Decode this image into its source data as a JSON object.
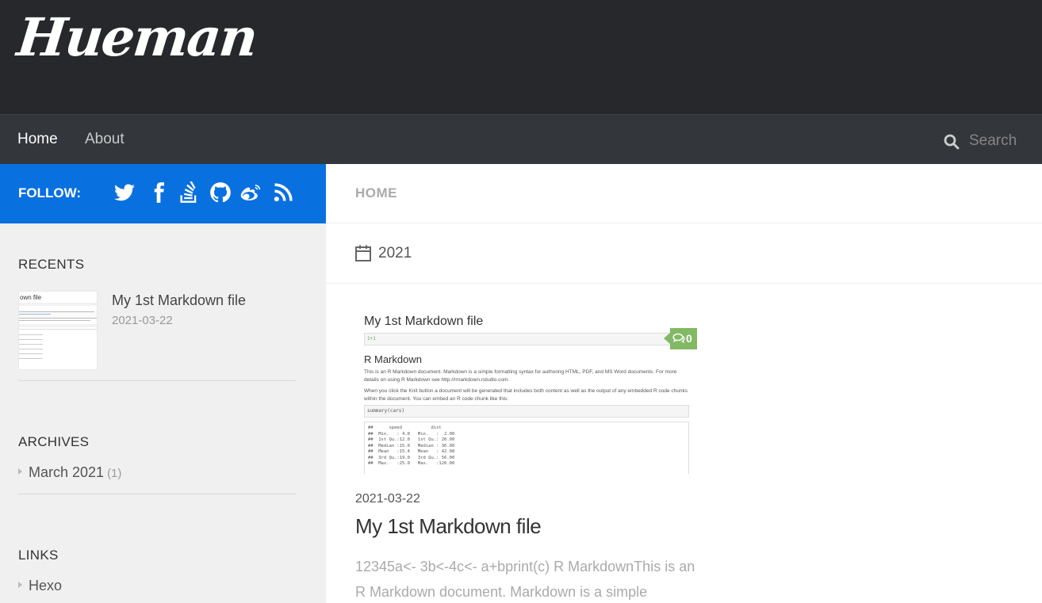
{
  "header": {
    "logo_text": "Hueman"
  },
  "nav": {
    "items": [
      {
        "label": "Home",
        "active": true
      },
      {
        "label": "About",
        "active": false
      }
    ],
    "search_placeholder": "Search"
  },
  "sidebar": {
    "follow_label": "FOLLOW:",
    "social_icons": [
      "twitter-icon",
      "facebook-icon",
      "stackoverflow-icon",
      "github-icon",
      "weibo-icon",
      "rss-icon"
    ],
    "recents": {
      "title": "RECENTS",
      "items": [
        {
          "title": "My 1st Markdown file",
          "date": "2021-03-22"
        }
      ]
    },
    "archives": {
      "title": "ARCHIVES",
      "items": [
        {
          "label": "March 2021",
          "count": "(1)"
        }
      ]
    },
    "links": {
      "title": "LINKS",
      "items": [
        {
          "label": "Hexo"
        }
      ]
    }
  },
  "main": {
    "breadcrumb": "HOME",
    "archive_year": "2021",
    "post": {
      "thumbnail": {
        "title": "My 1st Markdown file",
        "code1": "1+1",
        "h2": "R Markdown",
        "p1": "This is an R Markdown document. Markdown is a simple formatting syntax for authoring HTML, PDF, and MS Word documents. For more details on using R Markdown see http://rmarkdown.rstudio.com.",
        "p2": "When you click the Knit button a document will be generated that includes both content as well as the output of any embedded R code chunks within the document. You can embed an R code chunk like this:",
        "code2": "summary(cars)",
        "output": "##      speed           dist       \n##  Min.   : 4.0   Min.   :  2.00  \n##  1st Qu.:12.0   1st Qu.: 26.00  \n##  Median :15.0   Median : 36.00  \n##  Mean   :15.4   Mean   : 42.98  \n##  3rd Qu.:19.0   3rd Qu.: 56.00  \n##  Max.   :25.0   Max.   :120.00  "
      },
      "comment_count": "0",
      "date": "2021-03-22",
      "title": "My 1st Markdown file",
      "excerpt": "12345a<- 3b<-4c<- a+bprint(c) R MarkdownThis is an R Markdown document. Markdown is a simple"
    }
  },
  "colors": {
    "header_bg": "#27282b",
    "nav_bg": "#33363b",
    "follow_bg": "#0970e0",
    "comment_badge": "#82b965",
    "sidebar_bg": "#f0f0f0"
  }
}
